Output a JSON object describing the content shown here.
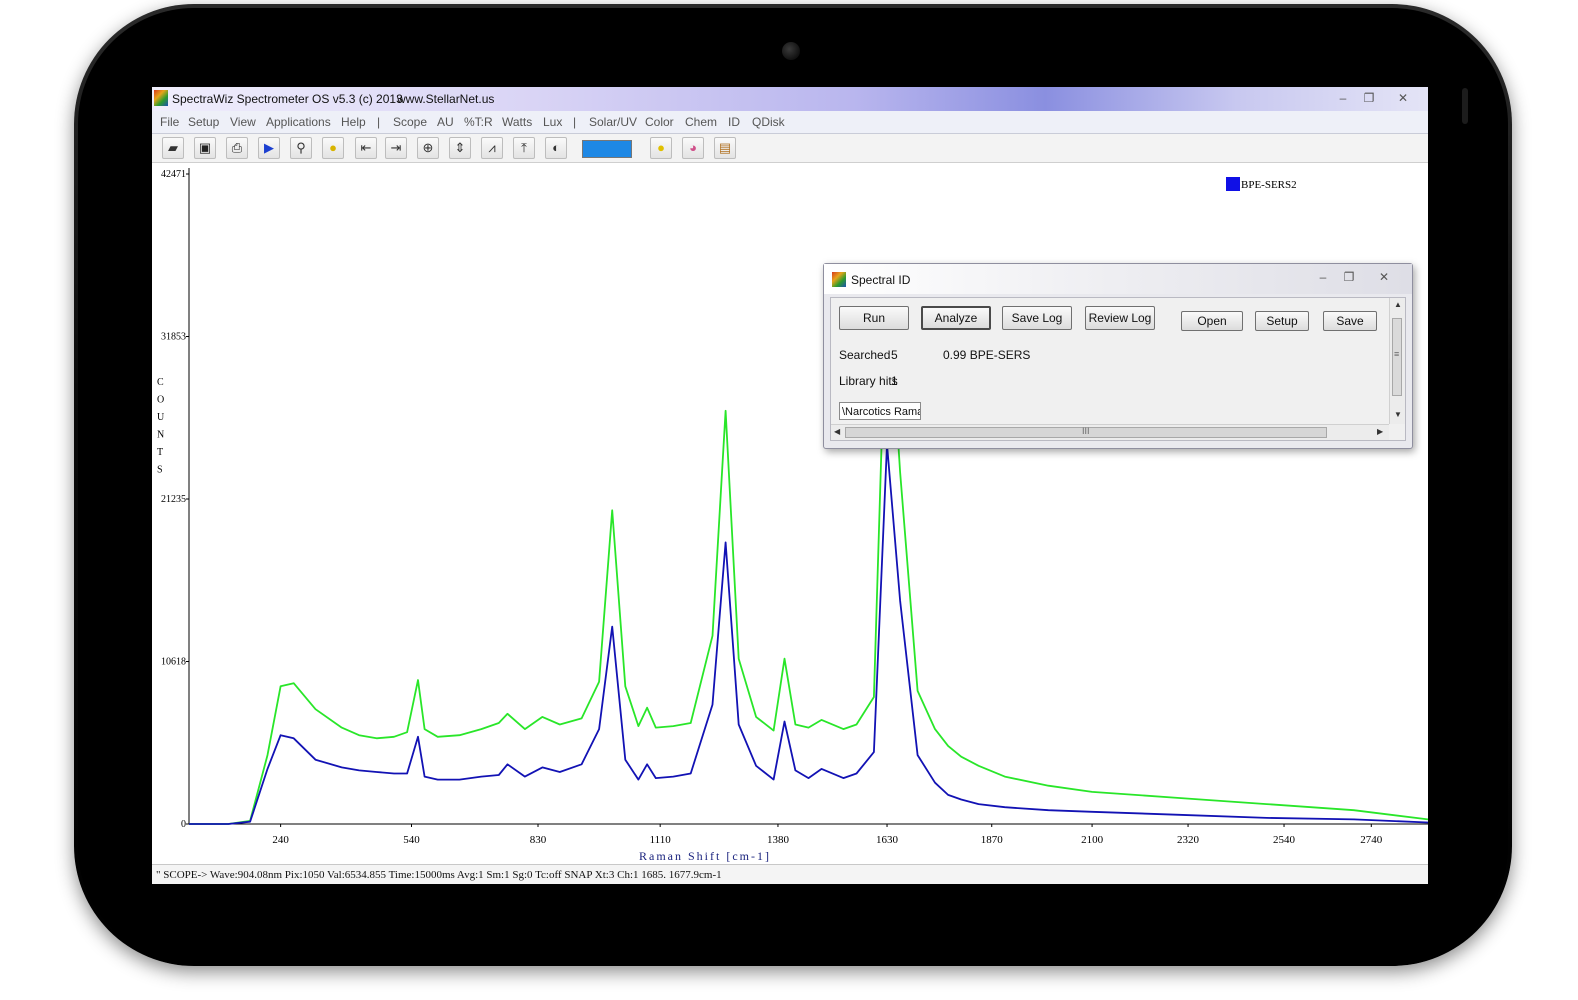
{
  "window": {
    "title": "SpectraWiz  Spectrometer OS v5.3 (c) 2013",
    "url": "www.StellarNet.us",
    "controls": [
      "–",
      "❐",
      "✕"
    ]
  },
  "menu": [
    "File",
    "Setup",
    "View",
    "Applications",
    "Help",
    "|",
    "Scope",
    "AU",
    "%T:R",
    "Watts",
    "Lux",
    "|",
    "Solar/UV",
    "Color",
    "Chem",
    "ID",
    "QDisk"
  ],
  "toolbar": {
    "icons": [
      "open-icon",
      "save-icon",
      "print-icon",
      "play-icon",
      "probe-icon",
      "bulb-icon",
      "left-bracket-icon",
      "right-bracket-icon",
      "zoom-icon",
      "autoscale-icon",
      "peak-icon",
      "upload-icon",
      "compare-icon",
      "color-swatch",
      "circle-icon",
      "color-wheel-icon",
      "export-icon"
    ],
    "swatch_color": "#1e88e5"
  },
  "chart_data": {
    "type": "line",
    "xlabel": "Raman Shift [cm-1]",
    "ylabel": "COUNTS",
    "ylabel_letters": [
      "C",
      "O",
      "U",
      "N",
      "T",
      "S"
    ],
    "yticks": [
      "42471",
      "31853",
      "21235",
      "10618",
      "0"
    ],
    "ytick_values": [
      42471,
      31853,
      21235,
      10618,
      0
    ],
    "xticks": [
      "240",
      "540",
      "830",
      "1110",
      "1380",
      "1630",
      "1870",
      "2100",
      "2320",
      "2540",
      "2740"
    ],
    "xtick_values": [
      240,
      540,
      830,
      1110,
      1380,
      1630,
      1870,
      2100,
      2320,
      2540,
      2740
    ],
    "xlim": [
      30,
      2870
    ],
    "ylim": [
      0,
      42471
    ],
    "legend": [
      {
        "name": "BPE-SERS2",
        "color": "#1010e6"
      }
    ],
    "legend_position": "top-right",
    "series": [
      {
        "color": "#29e629",
        "x": [
          30,
          120,
          170,
          210,
          240,
          270,
          320,
          380,
          420,
          460,
          500,
          530,
          555,
          570,
          600,
          650,
          700,
          740,
          760,
          800,
          840,
          880,
          930,
          970,
          1000,
          1030,
          1060,
          1080,
          1100,
          1140,
          1180,
          1230,
          1260,
          1290,
          1330,
          1370,
          1395,
          1420,
          1450,
          1480,
          1530,
          1560,
          1600,
          1630,
          1660,
          1700,
          1740,
          1770,
          1800,
          1840,
          1900,
          2000,
          2100,
          2300,
          2500,
          2700,
          2870
        ],
        "y": [
          0,
          0,
          200,
          4500,
          9000,
          9200,
          7500,
          6300,
          5800,
          5600,
          5700,
          6000,
          9400,
          6200,
          5700,
          5800,
          6200,
          6600,
          7200,
          6200,
          7000,
          6500,
          6900,
          9300,
          20500,
          9000,
          6400,
          7600,
          6300,
          6400,
          6600,
          12300,
          27000,
          10800,
          7000,
          6100,
          10800,
          6500,
          6300,
          6800,
          6200,
          6500,
          8300,
          36500,
          23000,
          8700,
          6200,
          5100,
          4400,
          3800,
          3100,
          2500,
          2100,
          1700,
          1300,
          900,
          300
        ]
      },
      {
        "color": "#1212b4",
        "x": [
          30,
          120,
          170,
          210,
          240,
          270,
          320,
          380,
          420,
          460,
          500,
          530,
          555,
          570,
          600,
          650,
          700,
          740,
          760,
          800,
          840,
          880,
          930,
          970,
          1000,
          1030,
          1060,
          1080,
          1100,
          1140,
          1180,
          1230,
          1260,
          1290,
          1330,
          1370,
          1395,
          1420,
          1450,
          1480,
          1530,
          1560,
          1600,
          1630,
          1660,
          1700,
          1740,
          1770,
          1800,
          1840,
          1900,
          2000,
          2100,
          2300,
          2500,
          2700,
          2870
        ],
        "y": [
          0,
          0,
          150,
          3600,
          5800,
          5600,
          4200,
          3700,
          3500,
          3400,
          3300,
          3300,
          5700,
          3100,
          2900,
          2900,
          3100,
          3200,
          3900,
          3100,
          3700,
          3400,
          3900,
          6200,
          12900,
          4200,
          2900,
          3900,
          3000,
          3100,
          3300,
          7800,
          18400,
          6500,
          3800,
          2900,
          6700,
          3500,
          3000,
          3600,
          3000,
          3300,
          4700,
          24800,
          14600,
          4500,
          2700,
          1900,
          1600,
          1300,
          1100,
          900,
          800,
          600,
          400,
          300,
          100
        ]
      }
    ]
  },
  "status": "\" SCOPE->  Wave:904.08nm  Pix:1050  Val:6534.855  Time:15000ms  Avg:1  Sm:1  Sg:0  Tc:off  SNAP  Xt:3  Ch:1   1685.  1677.9cm-1",
  "dialog": {
    "title": "Spectral ID",
    "controls": [
      "–",
      "❐",
      "✕"
    ],
    "buttons": {
      "run": "Run",
      "analyze": "Analyze",
      "save_log": "Save Log",
      "review_log": "Review Log",
      "open": "Open",
      "setup": "Setup",
      "save": "Save"
    },
    "searched_label": "Searched",
    "searched_value": "5",
    "result": "0.99  BPE-SERS",
    "library_hits_label": "Library hits",
    "library_hits_value": "1",
    "path": "\\Narcotics Ramar",
    "hscroll_marker": "III",
    "vscroll_marker": "≡"
  }
}
